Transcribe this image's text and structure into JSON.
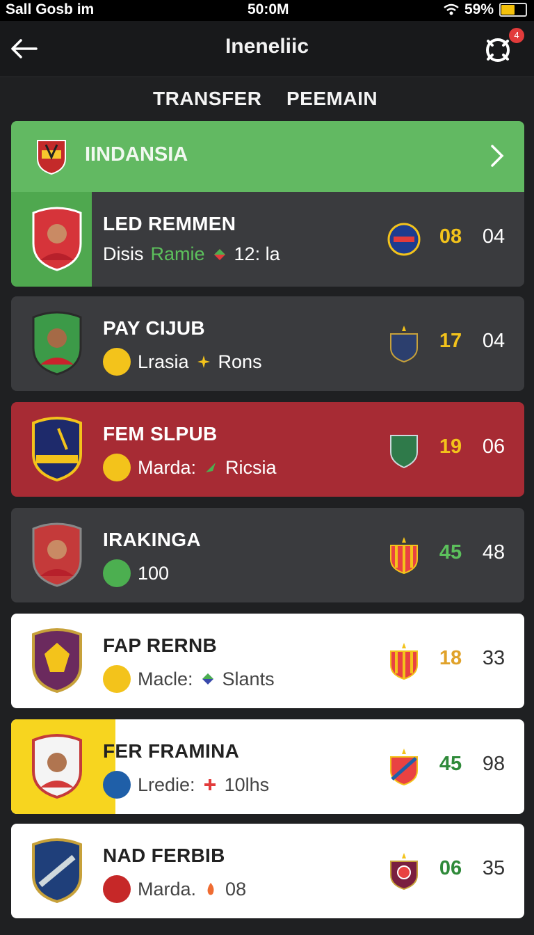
{
  "status_bar": {
    "carrier": "Sall Gosb im",
    "time": "50:0M",
    "battery": "59%",
    "battery_level": 0.59
  },
  "header": {
    "title": "Ineneliic",
    "notification_count": "4"
  },
  "tabs": [
    {
      "label": "TRANSFER"
    },
    {
      "label": "PEEMAIN"
    }
  ],
  "section": {
    "label": "IINDANSIA"
  },
  "cards": [
    {
      "name": "LED REMMEN",
      "sub_a": "Disis",
      "sub_b": "Ramie",
      "sub_c": "12: la",
      "score1": "08",
      "score2": "04",
      "theme": "dark",
      "accent": "#4fa84f",
      "score1_color": "#f3c31b"
    },
    {
      "name": "PAY CIJUB",
      "sub_a": "Lrasia",
      "sub_b": "",
      "sub_c": "Rons",
      "score1": "17",
      "score2": "04",
      "theme": "dark",
      "accent": "",
      "score1_color": "#f3c31b"
    },
    {
      "name": "FEM SLPUB",
      "sub_a": "Marda:",
      "sub_b": "",
      "sub_c": "Ricsia",
      "score1": "19",
      "score2": "06",
      "theme": "red",
      "accent": "",
      "score1_color": "#f3c31b"
    },
    {
      "name": "IRAKINGA",
      "sub_a": "100",
      "sub_b": "",
      "sub_c": "",
      "score1": "45",
      "score2": "48",
      "theme": "dark",
      "accent": "",
      "score1_color": "#5cc15c"
    },
    {
      "name": "FAP RERNB",
      "sub_a": "Macle:",
      "sub_b": "",
      "sub_c": "Slants",
      "score1": "18",
      "score2": "33",
      "theme": "white",
      "accent": "",
      "score1_color": "#e0a22a"
    },
    {
      "name": "FER FRAMINA",
      "sub_a": "Lredie:",
      "sub_b": "",
      "sub_c": "10lhs",
      "score1": "45",
      "score2": "98",
      "theme": "white",
      "accent": "#f7d51f",
      "score1_color": "#2f8a3a"
    },
    {
      "name": "NAD FERBIB",
      "sub_a": "Marda.",
      "sub_b": "",
      "sub_c": "08",
      "score1": "06",
      "score2": "35",
      "theme": "white",
      "accent": "",
      "score1_color": "#2f8a3a"
    }
  ]
}
